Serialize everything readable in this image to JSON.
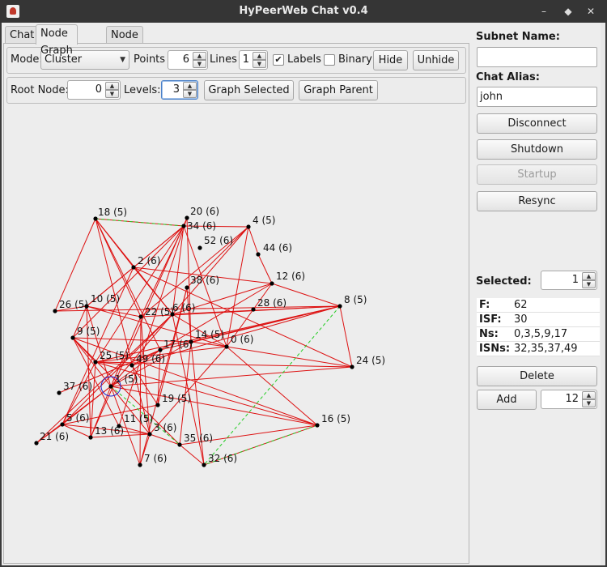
{
  "window": {
    "title": "HyPeerWeb Chat v0.4"
  },
  "tabs": [
    {
      "label": "Chat"
    },
    {
      "label": "Node Graph"
    },
    {
      "label": "Node List"
    }
  ],
  "toolbar1": {
    "mode_label": "Mode:",
    "mode_value": "Cluster",
    "points_label": "Points",
    "points_value": "6",
    "lines_label": "Lines",
    "lines_value": "1",
    "labels_label": "Labels",
    "labels_checked": true,
    "binary_label": "Binary",
    "binary_checked": false,
    "hide_label": "Hide",
    "unhide_label": "Unhide"
  },
  "toolbar2": {
    "root_label": "Root Node:",
    "root_value": "0",
    "levels_label": "Levels:",
    "levels_value": "3",
    "graph_selected_label": "Graph Selected",
    "graph_parent_label": "Graph Parent"
  },
  "side": {
    "subnet_label": "Subnet Name:",
    "subnet_value": "",
    "alias_label": "Chat Alias:",
    "alias_value": "john",
    "disconnect_label": "Disconnect",
    "shutdown_label": "Shutdown",
    "startup_label": "Startup",
    "resync_label": "Resync",
    "selected_label": "Selected:",
    "selected_value": "1",
    "info": [
      {
        "key": "F:",
        "value": "62"
      },
      {
        "key": "ISF:",
        "value": "30"
      },
      {
        "key": "Ns:",
        "value": "0,3,5,9,17"
      },
      {
        "key": "ISNs:",
        "value": "32,35,37,49"
      }
    ],
    "delete_label": "Delete",
    "add_label": "Add",
    "add_value": "12"
  },
  "graph": {
    "selected_node": "1",
    "edge_color": "#dd1111",
    "dashed_color": "#22cc22",
    "highlight_color": "#2222cc",
    "nodes": [
      {
        "id": "18",
        "label": "18 (5)"
      },
      {
        "id": "20",
        "label": "20 (6)"
      },
      {
        "id": "34",
        "label": "34 (6)"
      },
      {
        "id": "4",
        "label": "4 (5)"
      },
      {
        "id": "52",
        "label": "52 (6)"
      },
      {
        "id": "44",
        "label": "44 (6)"
      },
      {
        "id": "2",
        "label": "2 (6)"
      },
      {
        "id": "12",
        "label": "12 (6)"
      },
      {
        "id": "38",
        "label": "38 (6)"
      },
      {
        "id": "26",
        "label": "26 (5)"
      },
      {
        "id": "10",
        "label": "10 (5)"
      },
      {
        "id": "28",
        "label": "28 (6)"
      },
      {
        "id": "8",
        "label": "8 (5)"
      },
      {
        "id": "22",
        "label": "22 (5)"
      },
      {
        "id": "6",
        "label": "6 (6)"
      },
      {
        "id": "9",
        "label": "9 (5)"
      },
      {
        "id": "14",
        "label": "14 (5)"
      },
      {
        "id": "17",
        "label": "17 (6)"
      },
      {
        "id": "0",
        "label": "0 (6)"
      },
      {
        "id": "24",
        "label": "24 (5)"
      },
      {
        "id": "25",
        "label": "25 (5)"
      },
      {
        "id": "49",
        "label": "49 (6)"
      },
      {
        "id": "1",
        "label": "1 (5)"
      },
      {
        "id": "37",
        "label": "37 (6)"
      },
      {
        "id": "19",
        "label": "19 (5)"
      },
      {
        "id": "5",
        "label": "5 (6)"
      },
      {
        "id": "16",
        "label": "16 (5)"
      },
      {
        "id": "11",
        "label": "11 (5)"
      },
      {
        "id": "13",
        "label": "13 (6)"
      },
      {
        "id": "3",
        "label": "3 (6)"
      },
      {
        "id": "21",
        "label": "21 (6)"
      },
      {
        "id": "35",
        "label": "35 (6)"
      },
      {
        "id": "32",
        "label": "32 (6)"
      },
      {
        "id": "7",
        "label": "7 (6)"
      }
    ],
    "edges": [
      [
        "18",
        "34"
      ],
      [
        "18",
        "2"
      ],
      [
        "18",
        "26"
      ],
      [
        "18",
        "6"
      ],
      [
        "18",
        "22"
      ],
      [
        "18",
        "17"
      ],
      [
        "18",
        "3"
      ],
      [
        "34",
        "4"
      ],
      [
        "34",
        "2"
      ],
      [
        "34",
        "22"
      ],
      [
        "34",
        "6"
      ],
      [
        "34",
        "0"
      ],
      [
        "34",
        "10"
      ],
      [
        "34",
        "9"
      ],
      [
        "34",
        "25"
      ],
      [
        "20",
        "14"
      ],
      [
        "20",
        "13"
      ],
      [
        "20",
        "11"
      ],
      [
        "4",
        "44"
      ],
      [
        "4",
        "38"
      ],
      [
        "4",
        "0"
      ],
      [
        "4",
        "6"
      ],
      [
        "4",
        "22"
      ],
      [
        "44",
        "12"
      ],
      [
        "2",
        "12"
      ],
      [
        "2",
        "6"
      ],
      [
        "2",
        "24"
      ],
      [
        "2",
        "10"
      ],
      [
        "2",
        "5"
      ],
      [
        "12",
        "28"
      ],
      [
        "12",
        "6"
      ],
      [
        "12",
        "8"
      ],
      [
        "12",
        "17"
      ],
      [
        "38",
        "14"
      ],
      [
        "38",
        "19"
      ],
      [
        "38",
        "7"
      ],
      [
        "26",
        "10"
      ],
      [
        "26",
        "8"
      ],
      [
        "10",
        "22"
      ],
      [
        "10",
        "9"
      ],
      [
        "10",
        "1"
      ],
      [
        "10",
        "13"
      ],
      [
        "10",
        "0"
      ],
      [
        "28",
        "0"
      ],
      [
        "8",
        "22"
      ],
      [
        "8",
        "6"
      ],
      [
        "8",
        "14"
      ],
      [
        "8",
        "24"
      ],
      [
        "8",
        "17"
      ],
      [
        "8",
        "25"
      ],
      [
        "8",
        "49"
      ],
      [
        "22",
        "7"
      ],
      [
        "22",
        "3"
      ],
      [
        "22",
        "1"
      ],
      [
        "6",
        "0"
      ],
      [
        "6",
        "5"
      ],
      [
        "6",
        "21"
      ],
      [
        "6",
        "32"
      ],
      [
        "6",
        "1"
      ],
      [
        "9",
        "14"
      ],
      [
        "9",
        "25"
      ],
      [
        "9",
        "1"
      ],
      [
        "9",
        "11"
      ],
      [
        "9",
        "16"
      ],
      [
        "9",
        "35"
      ],
      [
        "14",
        "0"
      ],
      [
        "14",
        "1"
      ],
      [
        "14",
        "35"
      ],
      [
        "14",
        "32"
      ],
      [
        "17",
        "1"
      ],
      [
        "17",
        "49"
      ],
      [
        "17",
        "37"
      ],
      [
        "17",
        "19"
      ],
      [
        "0",
        "16"
      ],
      [
        "0",
        "3"
      ],
      [
        "0",
        "25"
      ],
      [
        "0",
        "24"
      ],
      [
        "24",
        "25"
      ],
      [
        "24",
        "1"
      ],
      [
        "25",
        "5"
      ],
      [
        "25",
        "13"
      ],
      [
        "25",
        "16"
      ],
      [
        "25",
        "49"
      ],
      [
        "49",
        "19"
      ],
      [
        "1",
        "16"
      ],
      [
        "1",
        "5"
      ],
      [
        "1",
        "21"
      ],
      [
        "1",
        "7"
      ],
      [
        "1",
        "13"
      ],
      [
        "1",
        "3"
      ],
      [
        "19",
        "5"
      ],
      [
        "5",
        "21"
      ],
      [
        "5",
        "13"
      ],
      [
        "5",
        "3"
      ],
      [
        "16",
        "32"
      ],
      [
        "16",
        "35"
      ],
      [
        "11",
        "3"
      ],
      [
        "13",
        "3"
      ],
      [
        "3",
        "35"
      ],
      [
        "3",
        "7"
      ],
      [
        "35",
        "32"
      ]
    ],
    "dashed_edges": [
      [
        "18",
        "34"
      ],
      [
        "8",
        "32"
      ],
      [
        "16",
        "32"
      ],
      [
        "1",
        "35"
      ]
    ]
  }
}
